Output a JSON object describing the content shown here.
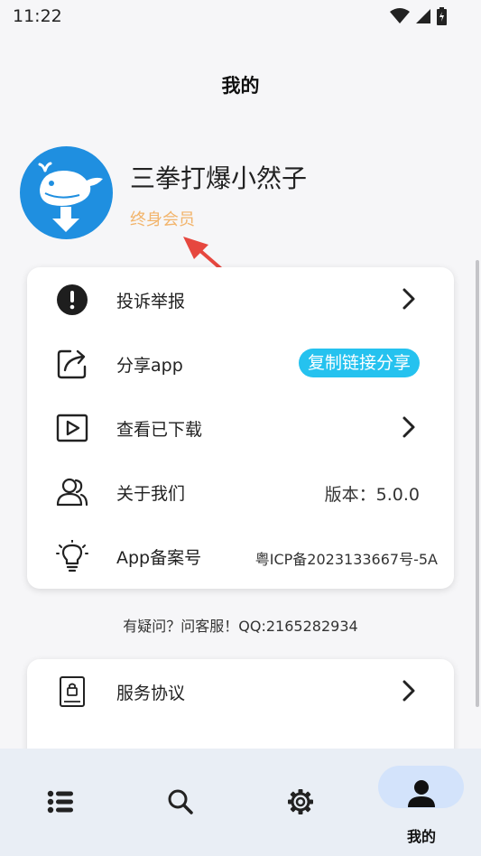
{
  "status_bar": {
    "time": "11:22"
  },
  "header": {
    "title": "我的"
  },
  "profile": {
    "username": "三拳打爆小然子",
    "membership": "终身会员"
  },
  "menu": {
    "items": [
      {
        "label": "投诉举报",
        "icon": "alert-icon",
        "trailing": "chevron"
      },
      {
        "label": "分享app",
        "icon": "share-icon",
        "trailing": "button",
        "button_label": "复制链接分享"
      },
      {
        "label": "查看已下载",
        "icon": "video-icon",
        "trailing": "chevron"
      },
      {
        "label": "关于我们",
        "icon": "people-icon",
        "trailing": "text",
        "value": "版本：5.0.0"
      },
      {
        "label": "App备案号",
        "icon": "lightbulb-icon",
        "trailing": "text",
        "value": "粤ICP备2023133667号-5A"
      }
    ]
  },
  "help": {
    "text": "有疑问？问客服！QQ:2165282934"
  },
  "menu2": {
    "items": [
      {
        "label": "服务协议",
        "icon": "document-lock-icon",
        "trailing": "chevron"
      }
    ]
  },
  "bottom_nav": {
    "items": [
      {
        "icon": "list-icon",
        "label": ""
      },
      {
        "icon": "search-icon",
        "label": ""
      },
      {
        "icon": "settings-icon",
        "label": ""
      },
      {
        "icon": "person-icon",
        "label": "我的",
        "active": true
      }
    ]
  },
  "colors": {
    "accent": "#25c2ef",
    "avatar_bg": "#1f8fe0",
    "membership": "#f2b46b",
    "nav_bg": "#e9eef5",
    "annotation": "#e6473f"
  }
}
